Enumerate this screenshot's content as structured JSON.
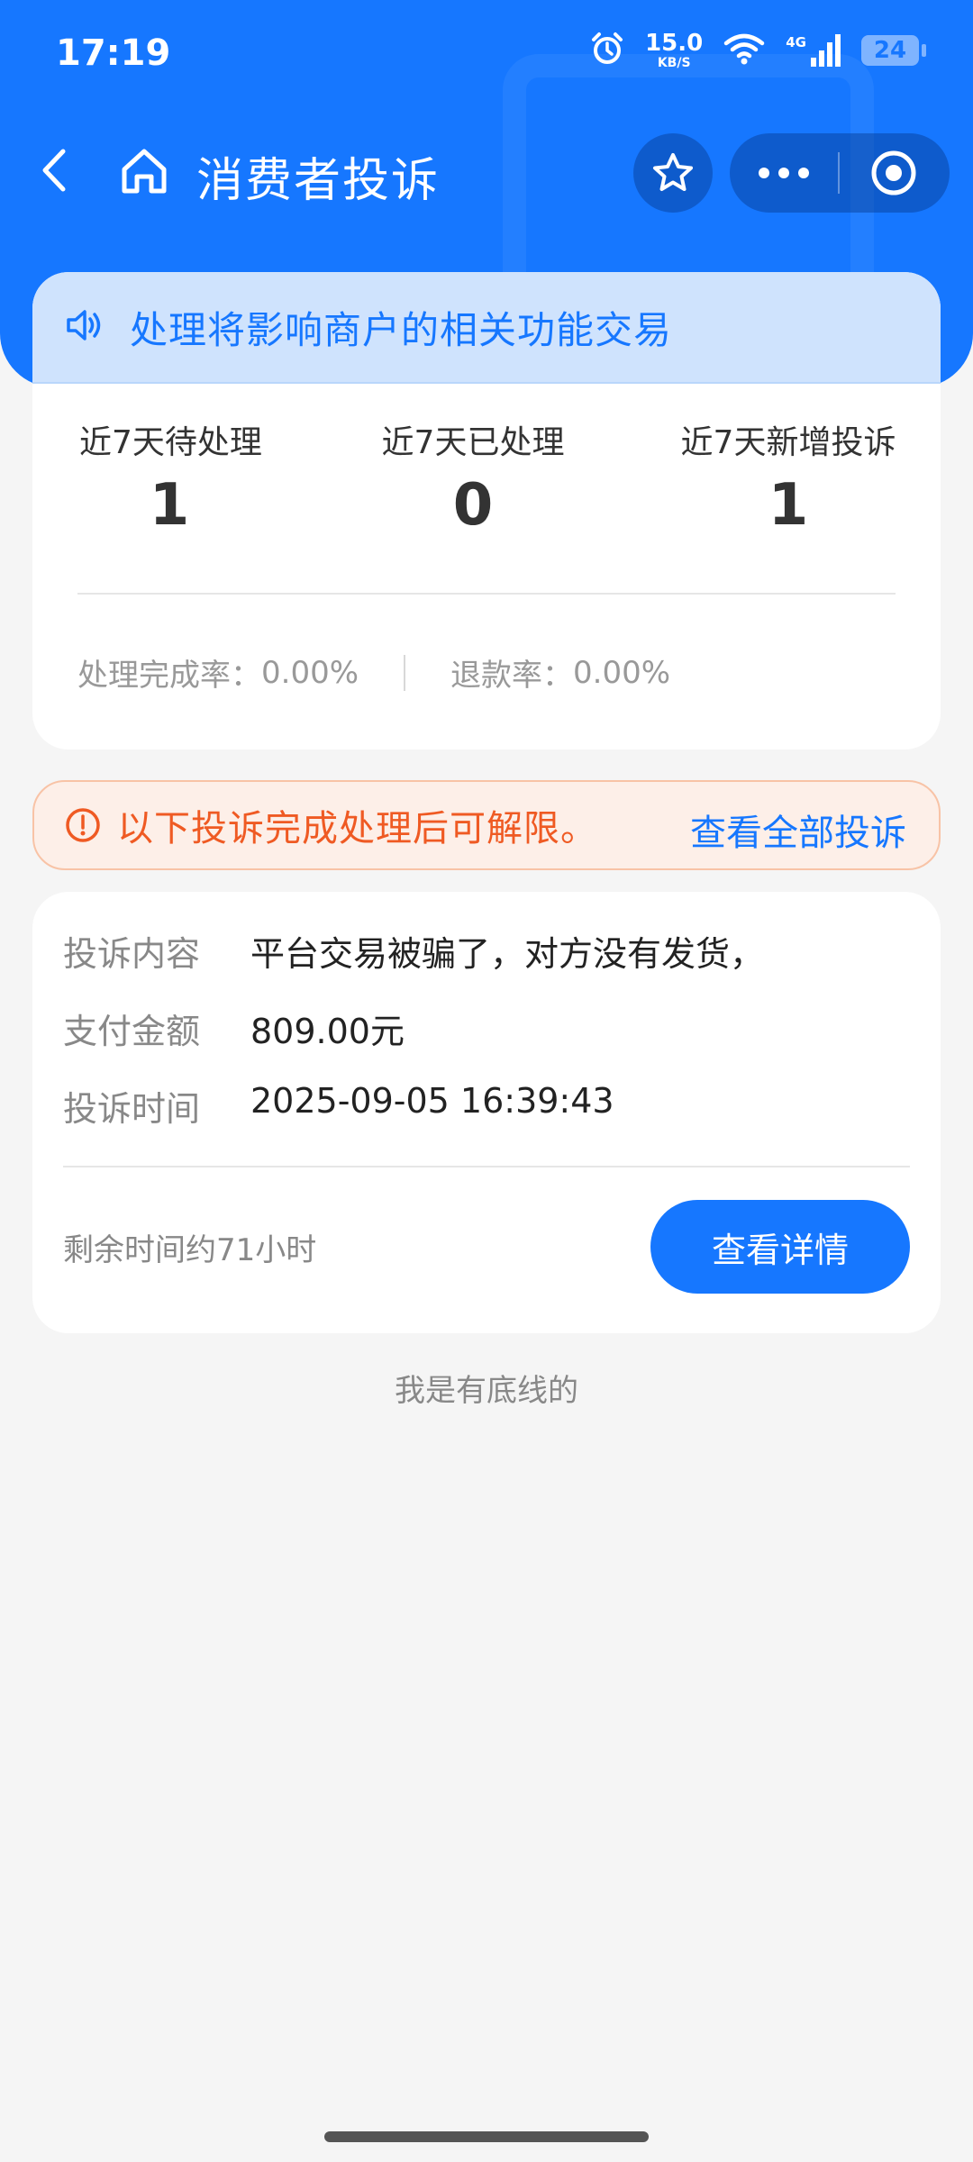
{
  "status_bar": {
    "time": "17:19",
    "net_speed_value": "15.0",
    "net_speed_unit": "KB/S",
    "network_type": "4G",
    "battery": "24"
  },
  "nav": {
    "title": "消费者投诉"
  },
  "notice": {
    "text": "处理将影响商户的相关功能交易"
  },
  "stats": {
    "pending_label": "近7天待处理",
    "pending_value": "1",
    "processed_label": "近7天已处理",
    "processed_value": "0",
    "new_label": "近7天新增投诉",
    "new_value": "1",
    "completion_rate_label": "处理完成率：",
    "completion_rate_value": "0.00%",
    "refund_rate_label": "退款率：",
    "refund_rate_value": "0.00%"
  },
  "warning": {
    "text": "以下投诉完成处理后可解限。",
    "link": "查看全部投诉"
  },
  "complaint": {
    "content_label": "投诉内容",
    "content_value": "平台交易被骗了，对方没有发货，",
    "amount_label": "支付金额",
    "amount_value": "809.00元",
    "time_label": "投诉时间",
    "time_value": "2025-09-05 16:39:43",
    "remaining": "剩余时间约71小时",
    "detail_button": "查看详情"
  },
  "footer": {
    "text": "我是有底线的"
  },
  "colors": {
    "primary": "#1677ff",
    "warning": "#ef5a23",
    "notice_bg": "#cfe3fd",
    "page_bg": "#f5f5f5"
  }
}
